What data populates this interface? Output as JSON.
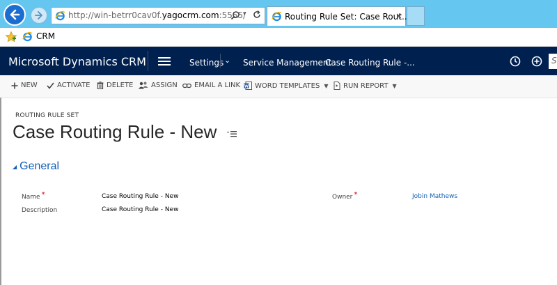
{
  "browser": {
    "url_prefix": "http://win-betrr0cav0f.",
    "url_domain": "yagocrm.com",
    "url_suffix": ":5555/",
    "tab_title": "Routing Rule Set: Case Rout...",
    "tab_close": "×",
    "favorites": [
      {
        "label": "CRM"
      }
    ]
  },
  "crm_nav": {
    "brand": "Microsoft Dynamics CRM",
    "area": "Settings",
    "subarea": "Service Management",
    "record": "Case Routing Rule -...",
    "search_text": "S"
  },
  "commands": [
    {
      "label": "NEW",
      "icon": "plus-icon"
    },
    {
      "label": "ACTIVATE",
      "icon": "check-icon"
    },
    {
      "label": "DELETE",
      "icon": "trash-icon"
    },
    {
      "label": "ASSIGN",
      "icon": "people-icon"
    },
    {
      "label": "EMAIL A LINK",
      "icon": "link-icon"
    },
    {
      "label": "WORD TEMPLATES",
      "icon": "word-icon"
    },
    {
      "label": "RUN REPORT",
      "icon": "report-icon"
    }
  ],
  "form": {
    "entity_label": "ROUTING RULE SET",
    "title": "Case Routing Rule - New",
    "section": "General",
    "fields": {
      "name": {
        "label": "Name",
        "value": "Case Routing Rule - New",
        "required": "*"
      },
      "description": {
        "label": "Description",
        "value": "Case Routing Rule - New"
      },
      "owner": {
        "label": "Owner",
        "value": "Jobin Mathews",
        "required": "*"
      }
    }
  },
  "colors": {
    "ie_chrome": "#65c6f0",
    "crm_nav": "#002050",
    "link": "#1160b7",
    "required": "#cc0000"
  }
}
